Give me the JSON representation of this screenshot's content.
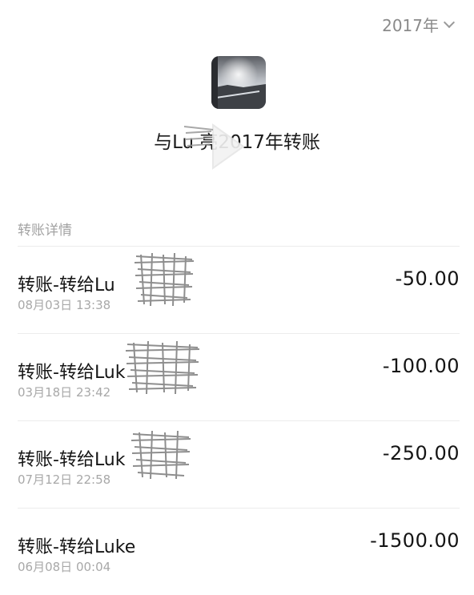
{
  "header": {
    "year_label": "2017年",
    "title": "与Lu    亮2017年转账",
    "avatar_icon": "avatar-landscape"
  },
  "section": {
    "label": "转账详情"
  },
  "transactions": [
    {
      "title": "转账-转给Lu",
      "time": "08月03日 13:38",
      "amount": "-50.00"
    },
    {
      "title": "转账-转给Luk",
      "time": "03月18日 23:42",
      "amount": "-100.00"
    },
    {
      "title": "转账-转给Luk",
      "time": "07月12日 22:58",
      "amount": "-250.00"
    },
    {
      "title": "转账-转给Luke",
      "time": "06月08日 00:04",
      "amount": "-1500.00"
    }
  ],
  "icons": {
    "chevron": "chevron-down-icon",
    "play": "play-icon"
  },
  "colors": {
    "text_primary": "#151515",
    "text_secondary": "#a8a8a8",
    "divider": "#ececec"
  }
}
